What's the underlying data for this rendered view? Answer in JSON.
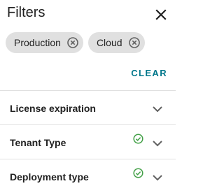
{
  "header": {
    "title": "Filters"
  },
  "chips": [
    {
      "label": "Production"
    },
    {
      "label": "Cloud"
    }
  ],
  "clear_label": "CLEAR",
  "sections": [
    {
      "label": "License expiration",
      "applied": false
    },
    {
      "label": "Tenant Type",
      "applied": true
    },
    {
      "label": "Deployment type",
      "applied": true
    }
  ],
  "colors": {
    "accent": "#00778b",
    "check": "#43a047",
    "chip_bg": "#e0e0e0"
  }
}
